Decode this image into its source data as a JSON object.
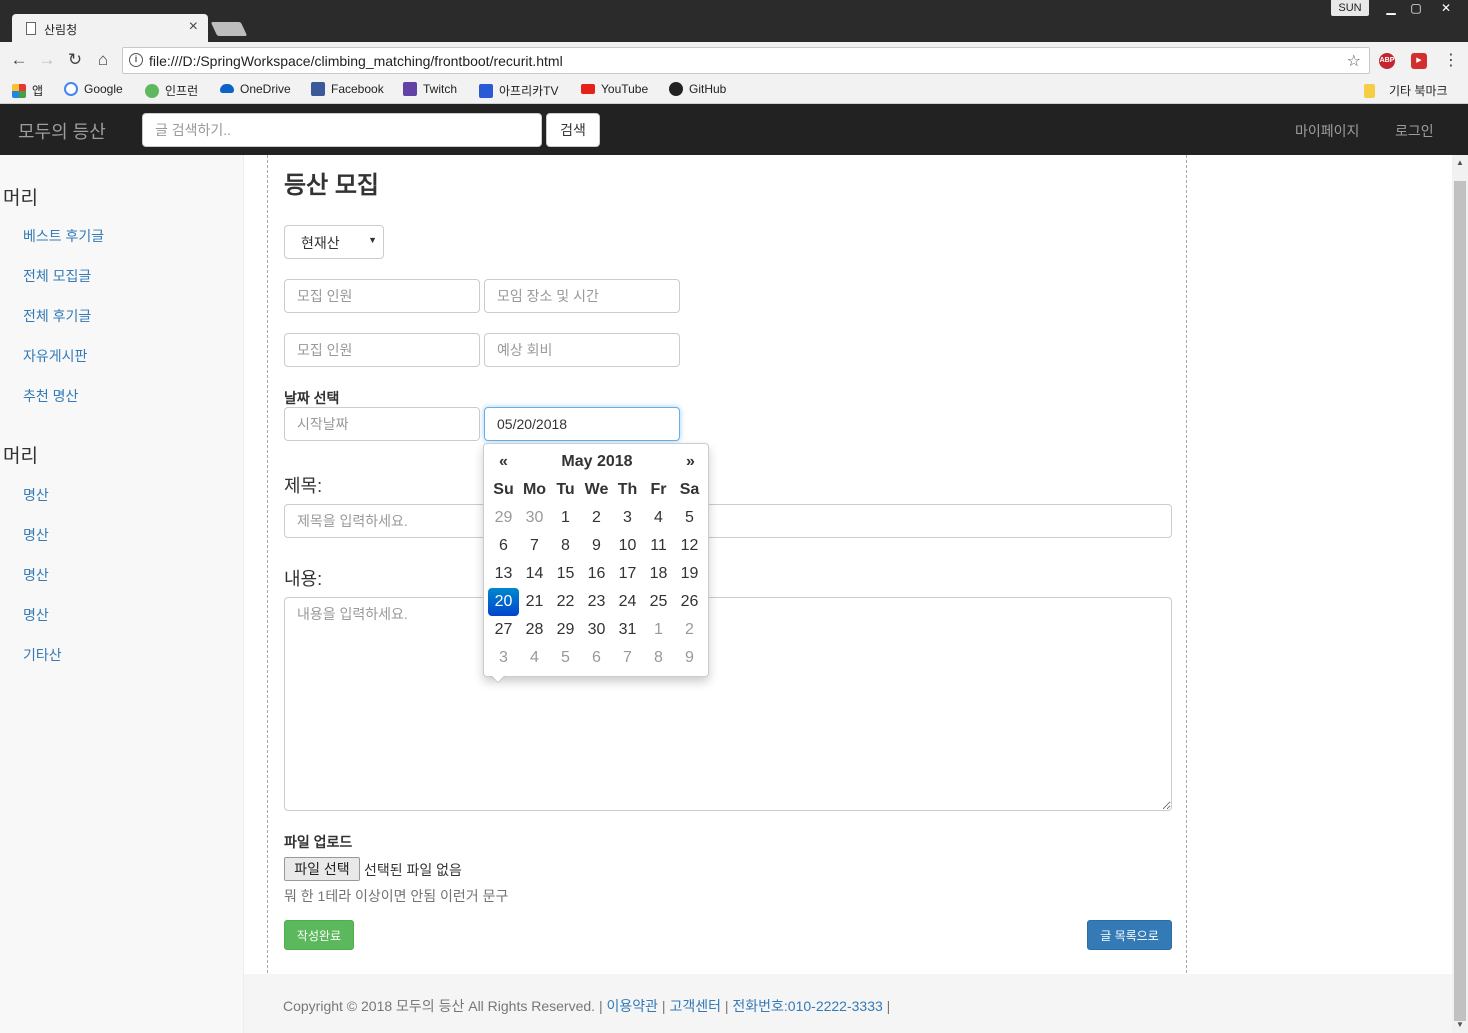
{
  "browser": {
    "tab_title": "산림청",
    "user": "SUN",
    "url": "file:///D:/SpringWorkspace/climbing_matching/frontboot/recurit.html",
    "bookmarks": [
      "앱",
      "Google",
      "인프런",
      "OneDrive",
      "Facebook",
      "Twitch",
      "아프리카TV",
      "YouTube",
      "GitHub"
    ],
    "other_bookmarks": "기타 북마크",
    "ext_abp": "ABP"
  },
  "navbar": {
    "brand": "모두의 등산",
    "search_placeholder": "글 검색하기..",
    "search_button": "검색",
    "mypage": "마이페이지",
    "login": "로그인"
  },
  "sidebar": {
    "groups": [
      {
        "title": "머리",
        "items": [
          "베스트 후기글",
          "전체 모집글",
          "전체 후기글",
          "자유게시판",
          "추천 명산"
        ]
      },
      {
        "title": "머리",
        "items": [
          "명산",
          "명산",
          "명산",
          "명산",
          "기타산"
        ]
      }
    ]
  },
  "form": {
    "title": "등산 모집",
    "mountain_select": "현재산",
    "recruit_count_placeholder": "모집 인원",
    "meeting_place_placeholder": "모임 장소 및 시간",
    "recruit_count2_placeholder": "모집 인원",
    "expected_fee_placeholder": "예상 회비",
    "date_label": "날짜 선택",
    "start_date_placeholder": "시작날짜",
    "end_date_value": "05/20/2018",
    "subject_label": "제목:",
    "subject_placeholder": "제목을 입력하세요.",
    "content_label": "내용:",
    "content_placeholder": "내용을 입력하세요.",
    "upload_label": "파일 업로드",
    "file_button": "파일 선택",
    "file_status": "선택된 파일 없음",
    "help_text": "뭐 한 1테라 이상이면 안됨 이런거 문구",
    "submit": "작성완료",
    "back_to_list": "글 목록으로"
  },
  "datepicker": {
    "month_label": "May 2018",
    "prev": "«",
    "next": "»",
    "weekdays": [
      "Su",
      "Mo",
      "Tu",
      "We",
      "Th",
      "Fr",
      "Sa"
    ],
    "weeks": [
      [
        "29",
        "30",
        "1",
        "2",
        "3",
        "4",
        "5"
      ],
      [
        "6",
        "7",
        "8",
        "9",
        "10",
        "11",
        "12"
      ],
      [
        "13",
        "14",
        "15",
        "16",
        "17",
        "18",
        "19"
      ],
      [
        "20",
        "21",
        "22",
        "23",
        "24",
        "25",
        "26"
      ],
      [
        "27",
        "28",
        "29",
        "30",
        "31",
        "1",
        "2"
      ],
      [
        "3",
        "4",
        "5",
        "6",
        "7",
        "8",
        "9"
      ]
    ],
    "other_month_cells": [
      [
        0,
        0
      ],
      [
        0,
        1
      ],
      [
        4,
        5
      ],
      [
        4,
        6
      ],
      [
        5,
        0
      ],
      [
        5,
        1
      ],
      [
        5,
        2
      ],
      [
        5,
        3
      ],
      [
        5,
        4
      ],
      [
        5,
        5
      ],
      [
        5,
        6
      ]
    ],
    "selected": "20",
    "selected_color": "#0d6fc7"
  },
  "footer": {
    "copyright": "Copyright © 2018 모두의 등산 All Rights Reserved. |",
    "terms": "이용약관",
    "sep1": "|",
    "support": "고객센터",
    "sep2": "|",
    "phone": "전화번호:010-2222-3333",
    "sep3": "|"
  },
  "colors": {
    "navbar_bg": "#222222",
    "link": "#337ab7",
    "success": "#5cb85c",
    "primary": "#337ab7"
  }
}
